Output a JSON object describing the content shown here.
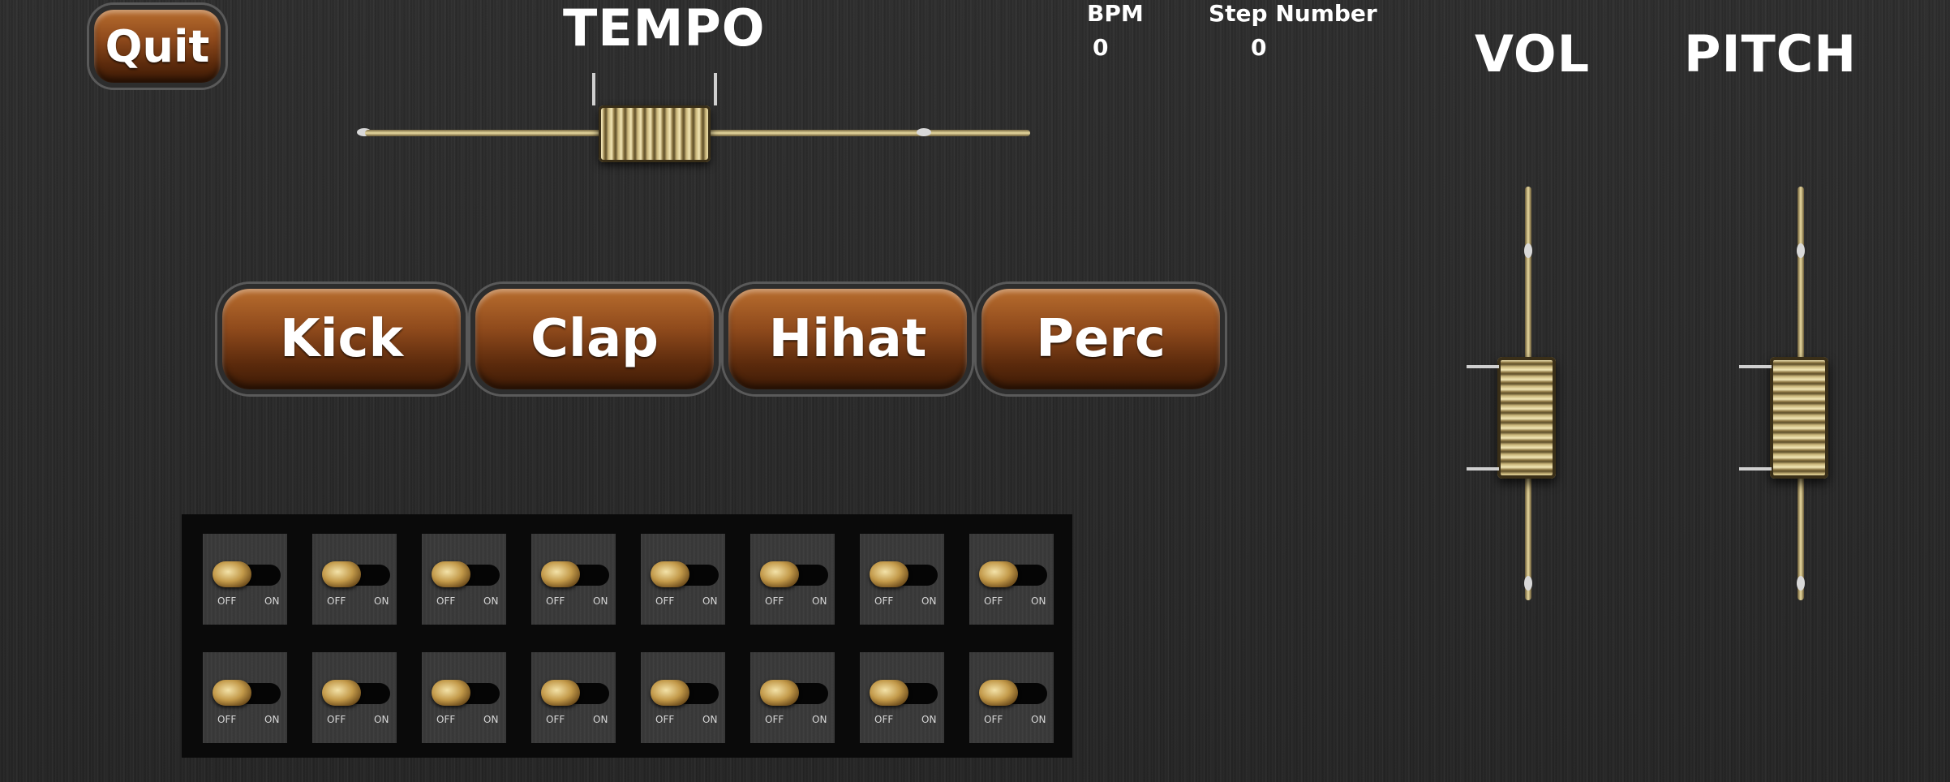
{
  "header": {
    "quit_label": "Quit",
    "tempo_label": "TEMPO",
    "bpm_label": "BPM",
    "bpm_value": "0",
    "step_label": "Step Number",
    "step_value": "0"
  },
  "sliders": {
    "vol_label": "VOL",
    "pitch_label": "PITCH"
  },
  "instruments": [
    {
      "label": "Kick"
    },
    {
      "label": "Clap"
    },
    {
      "label": "Hihat"
    },
    {
      "label": "Perc"
    }
  ],
  "sequencer": {
    "off_label": "OFF",
    "on_label": "ON",
    "rows": 2,
    "steps_per_row": 8
  },
  "colors": {
    "button_brown": "#8f4a1c",
    "brass": "#c9b57a",
    "background": "#2a2a2a"
  }
}
